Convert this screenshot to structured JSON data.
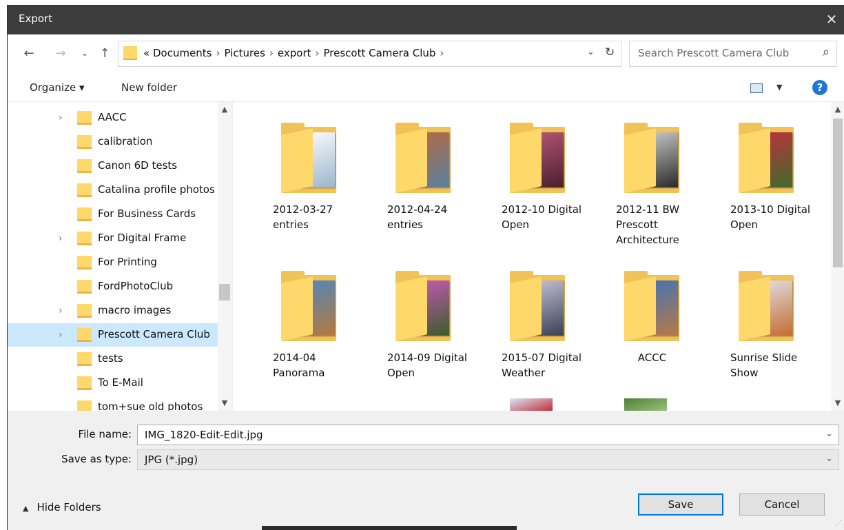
{
  "window": {
    "title": "Export",
    "close_glyph": "✕"
  },
  "nav": {
    "back": "←",
    "forward": "→",
    "recent": "⌄",
    "up": "↑",
    "breadcrumbs": [
      "«",
      "Documents",
      "Pictures",
      "export",
      "Prescott Camera Club"
    ],
    "sep": "›",
    "address_dropdown": "⌄",
    "refresh": "↻",
    "search_placeholder": "Search Prescott Camera Club",
    "search_glyph": "⌕"
  },
  "toolbar": {
    "organize": "Organize ▾",
    "new_folder": "New folder",
    "view_dd": "▼",
    "help": "?"
  },
  "tree": [
    {
      "label": "AACC",
      "expand": true,
      "selected": false
    },
    {
      "label": "calibration",
      "expand": false,
      "selected": false
    },
    {
      "label": "Canon 6D tests",
      "expand": false,
      "selected": false
    },
    {
      "label": "Catalina profile photos",
      "expand": false,
      "selected": false
    },
    {
      "label": "For Business Cards",
      "expand": false,
      "selected": false
    },
    {
      "label": "For Digital Frame",
      "expand": true,
      "selected": false
    },
    {
      "label": "For Printing",
      "expand": false,
      "selected": false
    },
    {
      "label": "FordPhotoClub",
      "expand": false,
      "selected": false
    },
    {
      "label": "macro images",
      "expand": true,
      "selected": false
    },
    {
      "label": "Prescott Camera Club",
      "expand": true,
      "selected": true
    },
    {
      "label": "tests",
      "expand": false,
      "selected": false
    },
    {
      "label": "To E-Mail",
      "expand": false,
      "selected": false
    },
    {
      "label": "tom+sue old photos",
      "expand": false,
      "selected": false
    }
  ],
  "tree_expand_glyph": "›",
  "scroll": {
    "up": "▲",
    "down": "▼"
  },
  "folders": [
    {
      "name": "2012-03-27 entries",
      "lines": [
        "2012-03-27",
        "entries"
      ],
      "colors": [
        "#ffffff",
        "#9bb6cc"
      ],
      "centered": false
    },
    {
      "name": "2012-04-24 entries",
      "lines": [
        "2012-04-24",
        "entries"
      ],
      "colors": [
        "#b56a3e",
        "#5a7fa0"
      ],
      "centered": false
    },
    {
      "name": "2012-10 Digital Open",
      "lines": [
        "2012-10 Digital",
        "Open"
      ],
      "colors": [
        "#b9587a",
        "#4a1f2c"
      ],
      "centered": false
    },
    {
      "name": "2012-11 BW Prescott Architecture",
      "lines": [
        "2012-11 BW",
        "Prescott",
        "Architecture"
      ],
      "colors": [
        "#cfcfcf",
        "#2a2a2a"
      ],
      "centered": false
    },
    {
      "name": "2013-10 Digital Open",
      "lines": [
        "2013-10 Digital",
        "Open"
      ],
      "colors": [
        "#c0303a",
        "#3f6b2c"
      ],
      "centered": false
    },
    {
      "name": "2014-04 Panorama",
      "lines": [
        "2014-04",
        "Panorama"
      ],
      "colors": [
        "#4f86c2",
        "#b5793c"
      ],
      "centered": false
    },
    {
      "name": "2014-09 Digital Open",
      "lines": [
        "2014-09 Digital",
        "Open"
      ],
      "colors": [
        "#c95ab8",
        "#3b5a2a"
      ],
      "centered": false
    },
    {
      "name": "2015-07 Digital Weather",
      "lines": [
        "2015-07 Digital",
        "Weather"
      ],
      "colors": [
        "#c8c8d8",
        "#3a3f55"
      ],
      "centered": false
    },
    {
      "name": "ACCC",
      "lines": [
        "ACCC"
      ],
      "colors": [
        "#3f72b8",
        "#b77a48"
      ],
      "centered": true
    },
    {
      "name": "Sunrise Slide Show",
      "lines": [
        "Sunrise Slide",
        "Show"
      ],
      "colors": [
        "#e0e4ea",
        "#c46b2e"
      ],
      "centered": false
    }
  ],
  "partial_thumbs": [
    {
      "colors": [
        "#d8e6f4",
        "#c0303a"
      ]
    },
    {
      "colors": [
        "#4f7f3a",
        "#9bc07a"
      ]
    }
  ],
  "form": {
    "file_name_label": "File name:",
    "file_name_value": "IMG_1820-Edit-Edit.jpg",
    "save_type_label": "Save as type:",
    "save_type_value": "JPG (*.jpg)",
    "chevron": "⌄"
  },
  "actions": {
    "hide_folders": "Hide Folders",
    "hide_caret": "▲",
    "save": "Save",
    "cancel": "Cancel"
  }
}
